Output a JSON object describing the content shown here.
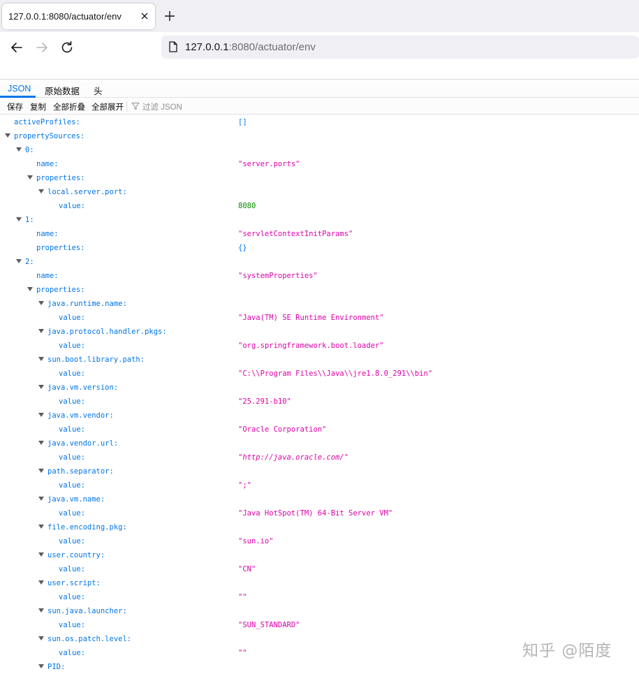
{
  "browser": {
    "tab_title": "127.0.0.1:8080/actuator/env",
    "url_host": "127.0.0.1",
    "url_rest": ":8080/actuator/env"
  },
  "viewer": {
    "tabs": [
      "JSON",
      "原始数据",
      "头"
    ],
    "toolbar": {
      "save": "保存",
      "copy": "复制",
      "collapse_all": "全部折叠",
      "expand_all": "全部展开",
      "filter_placeholder": "过滤 JSON"
    }
  },
  "tree": [
    {
      "key": "activeProfiles:",
      "depth": 0,
      "twisty": false,
      "value": "[]",
      "vtype": "obj"
    },
    {
      "key": "propertySources:",
      "depth": 0,
      "twisty": true,
      "value": null,
      "vtype": null
    },
    {
      "key": "0:",
      "depth": 1,
      "twisty": true,
      "value": null,
      "vtype": null
    },
    {
      "key": "name:",
      "depth": 2,
      "twisty": false,
      "value": "\"server.ports\"",
      "vtype": "str"
    },
    {
      "key": "properties:",
      "depth": 2,
      "twisty": true,
      "value": null,
      "vtype": null
    },
    {
      "key": "local.server.port:",
      "depth": 3,
      "twisty": true,
      "value": null,
      "vtype": null
    },
    {
      "key": "value:",
      "depth": 4,
      "twisty": false,
      "value": "8080",
      "vtype": "num"
    },
    {
      "key": "1:",
      "depth": 1,
      "twisty": true,
      "value": null,
      "vtype": null
    },
    {
      "key": "name:",
      "depth": 2,
      "twisty": false,
      "value": "\"servletContextInitParams\"",
      "vtype": "str"
    },
    {
      "key": "properties:",
      "depth": 2,
      "twisty": false,
      "value": "{}",
      "vtype": "obj"
    },
    {
      "key": "2:",
      "depth": 1,
      "twisty": true,
      "value": null,
      "vtype": null
    },
    {
      "key": "name:",
      "depth": 2,
      "twisty": false,
      "value": "\"systemProperties\"",
      "vtype": "str"
    },
    {
      "key": "properties:",
      "depth": 2,
      "twisty": true,
      "value": null,
      "vtype": null
    },
    {
      "key": "java.runtime.name:",
      "depth": 3,
      "twisty": true,
      "value": null,
      "vtype": null
    },
    {
      "key": "value:",
      "depth": 4,
      "twisty": false,
      "value": "\"Java(TM) SE Runtime Environment\"",
      "vtype": "str"
    },
    {
      "key": "java.protocol.handler.pkgs:",
      "depth": 3,
      "twisty": true,
      "value": null,
      "vtype": null
    },
    {
      "key": "value:",
      "depth": 4,
      "twisty": false,
      "value": "\"org.springframework.boot.loader\"",
      "vtype": "str"
    },
    {
      "key": "sun.boot.library.path:",
      "depth": 3,
      "twisty": true,
      "value": null,
      "vtype": null
    },
    {
      "key": "value:",
      "depth": 4,
      "twisty": false,
      "value": "\"C:\\\\Program Files\\\\Java\\\\jre1.8.0_291\\\\bin\"",
      "vtype": "str"
    },
    {
      "key": "java.vm.version:",
      "depth": 3,
      "twisty": true,
      "value": null,
      "vtype": null
    },
    {
      "key": "value:",
      "depth": 4,
      "twisty": false,
      "value": "\"25.291-b10\"",
      "vtype": "str"
    },
    {
      "key": "java.vm.vendor:",
      "depth": 3,
      "twisty": true,
      "value": null,
      "vtype": null
    },
    {
      "key": "value:",
      "depth": 4,
      "twisty": false,
      "value": "\"Oracle Corporation\"",
      "vtype": "str"
    },
    {
      "key": "java.vendor.url:",
      "depth": 3,
      "twisty": true,
      "value": null,
      "vtype": null
    },
    {
      "key": "value:",
      "depth": 4,
      "twisty": false,
      "value": "\"http://java.oracle.com/\"",
      "vtype": "str url-val"
    },
    {
      "key": "path.separator:",
      "depth": 3,
      "twisty": true,
      "value": null,
      "vtype": null
    },
    {
      "key": "value:",
      "depth": 4,
      "twisty": false,
      "value": "\";\"",
      "vtype": "str"
    },
    {
      "key": "java.vm.name:",
      "depth": 3,
      "twisty": true,
      "value": null,
      "vtype": null
    },
    {
      "key": "value:",
      "depth": 4,
      "twisty": false,
      "value": "\"Java HotSpot(TM) 64-Bit Server VM\"",
      "vtype": "str"
    },
    {
      "key": "file.encoding.pkg:",
      "depth": 3,
      "twisty": true,
      "value": null,
      "vtype": null
    },
    {
      "key": "value:",
      "depth": 4,
      "twisty": false,
      "value": "\"sun.io\"",
      "vtype": "str"
    },
    {
      "key": "user.country:",
      "depth": 3,
      "twisty": true,
      "value": null,
      "vtype": null
    },
    {
      "key": "value:",
      "depth": 4,
      "twisty": false,
      "value": "\"CN\"",
      "vtype": "str"
    },
    {
      "key": "user.script:",
      "depth": 3,
      "twisty": true,
      "value": null,
      "vtype": null
    },
    {
      "key": "value:",
      "depth": 4,
      "twisty": false,
      "value": "\"\"",
      "vtype": "str"
    },
    {
      "key": "sun.java.launcher:",
      "depth": 3,
      "twisty": true,
      "value": null,
      "vtype": null
    },
    {
      "key": "value:",
      "depth": 4,
      "twisty": false,
      "value": "\"SUN_STANDARD\"",
      "vtype": "str"
    },
    {
      "key": "sun.os.patch.level:",
      "depth": 3,
      "twisty": true,
      "value": null,
      "vtype": null
    },
    {
      "key": "value:",
      "depth": 4,
      "twisty": false,
      "value": "\"\"",
      "vtype": "str"
    },
    {
      "key": "PID:",
      "depth": 3,
      "twisty": true,
      "value": null,
      "vtype": null
    }
  ],
  "watermark": "知乎 @陌度",
  "colors": {
    "accent": "#0074e8",
    "string": "#dd00a9",
    "number": "#058b00"
  }
}
